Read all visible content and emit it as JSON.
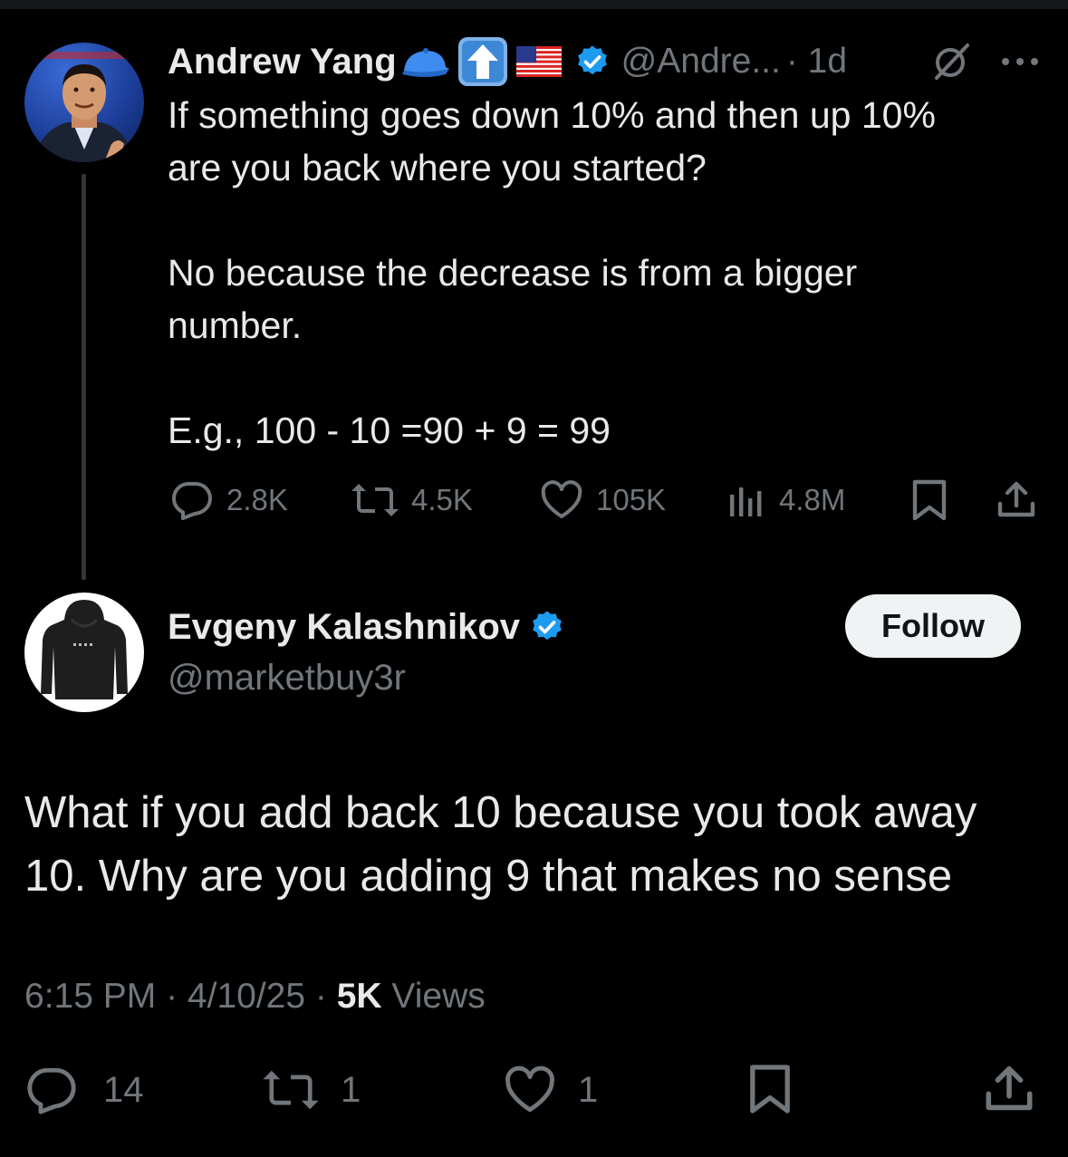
{
  "colors": {
    "background": "#000000",
    "text": "#e7e9ea",
    "muted": "#71767b",
    "verified": "#1d9bf0",
    "follow_bg": "#eff3f4"
  },
  "parent": {
    "author_name": "Andrew Yang",
    "name_emojis": [
      "blue-cap-icon",
      "up-arrow-icon",
      "us-flag-icon"
    ],
    "handle": "@Andre...",
    "time": "· 1d",
    "text": "If something goes down 10% and then up 10%\nare you back where you started?\n\nNo because the decrease is from a bigger\nnumber.\n\nE.g., 100 - 10 =90 + 9 = 99",
    "stats": {
      "replies": "2.8K",
      "reposts": "4.5K",
      "likes": "105K",
      "views": "4.8M"
    }
  },
  "reply": {
    "author_name": "Evgeny Kalashnikov",
    "handle": "@marketbuy3r",
    "follow_label": "Follow",
    "text": "What if you add back 10 because you took away 10. Why are you adding 9 that makes no sense",
    "time": "6:15 PM",
    "date": "4/10/25",
    "views_count": "5K",
    "views_label": "Views",
    "stats": {
      "replies": "14",
      "reposts": "1",
      "likes": "1"
    }
  }
}
